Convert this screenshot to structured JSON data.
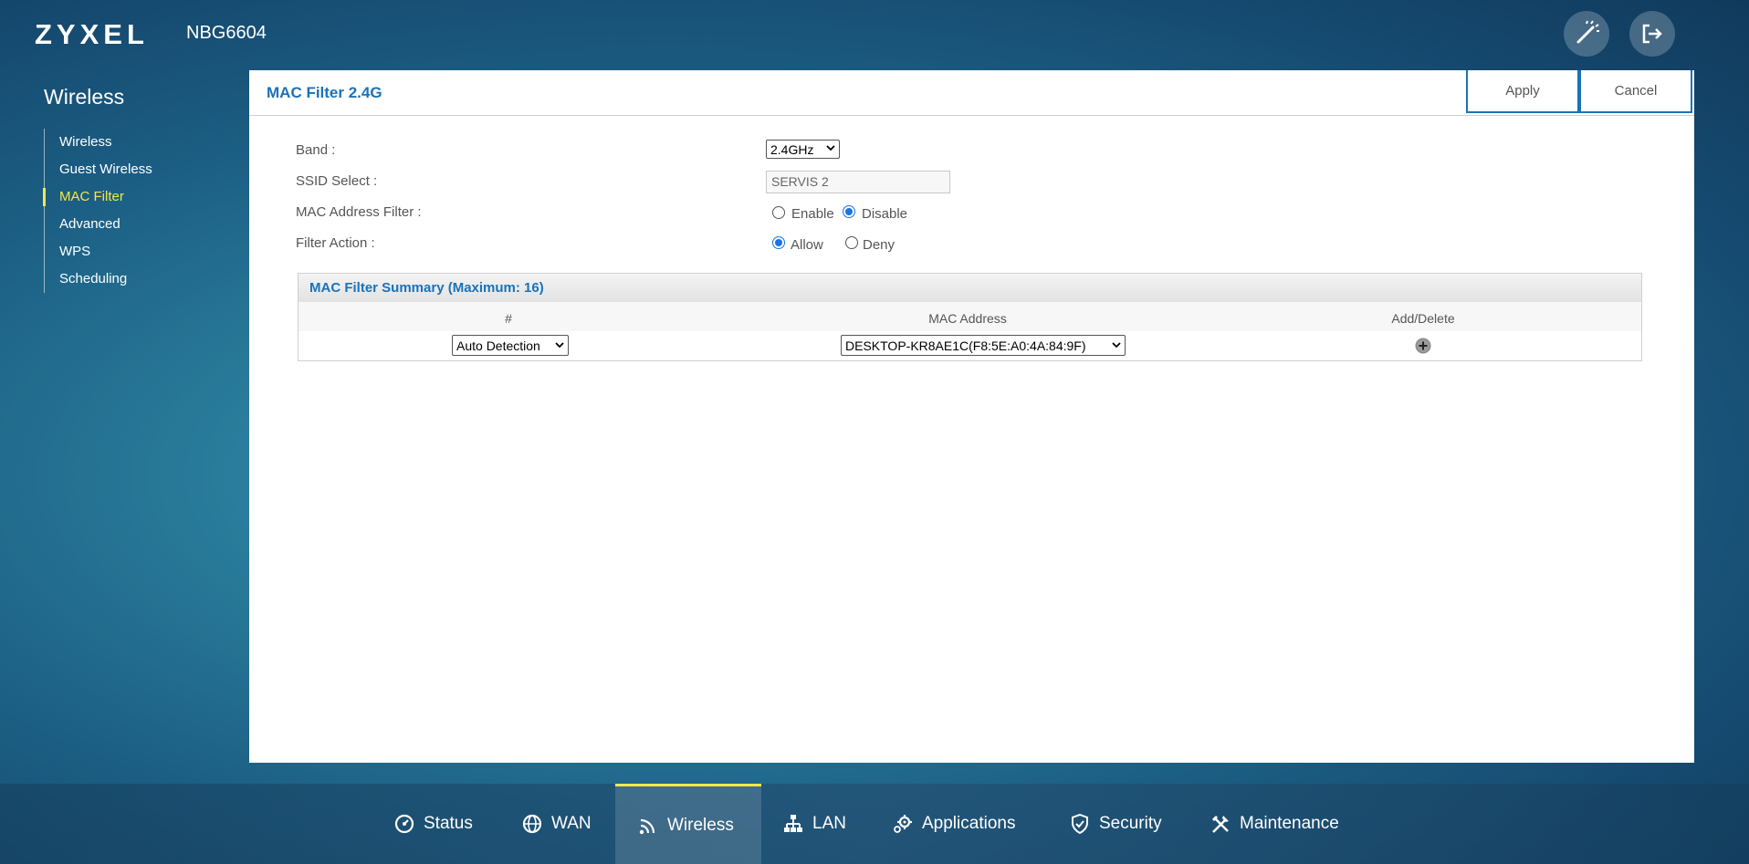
{
  "header": {
    "brand": "ZYXEL",
    "model": "NBG6604"
  },
  "sidebar": {
    "title": "Wireless",
    "items": [
      {
        "label": "Wireless"
      },
      {
        "label": "Guest Wireless"
      },
      {
        "label": "MAC Filter"
      },
      {
        "label": "Advanced"
      },
      {
        "label": "WPS"
      },
      {
        "label": "Scheduling"
      }
    ]
  },
  "panel": {
    "title": "MAC Filter 2.4G",
    "apply_label": "Apply",
    "cancel_label": "Cancel"
  },
  "form": {
    "band_label": "Band :",
    "band_value": "2.4GHz",
    "ssid_label": "SSID Select :",
    "ssid_value": "SERVIS 2",
    "mac_filter_label": "MAC Address Filter :",
    "mac_filter_enable": "Enable",
    "mac_filter_disable": "Disable",
    "mac_filter_selected": "Disable",
    "filter_action_label": "Filter Action :",
    "filter_action_allow": "Allow",
    "filter_action_deny": "Deny",
    "filter_action_selected": "Allow"
  },
  "summary": {
    "title": "MAC Filter Summary (Maximum: 16)",
    "columns": [
      "#",
      "MAC Address",
      "Add/Delete"
    ],
    "row": {
      "number_select": "Auto Detection",
      "mac_select": "DESKTOP-KR8AE1C(F8:5E:A0:4A:84:9F)"
    }
  },
  "bottom_nav": [
    {
      "label": "Status",
      "icon": "status-icon"
    },
    {
      "label": "WAN",
      "icon": "globe-icon"
    },
    {
      "label": "Wireless",
      "icon": "wifi-icon"
    },
    {
      "label": "LAN",
      "icon": "network-icon"
    },
    {
      "label": "Applications",
      "icon": "gear-icon"
    },
    {
      "label": "Security",
      "icon": "shield-icon"
    },
    {
      "label": "Maintenance",
      "icon": "tools-icon"
    }
  ],
  "colors": {
    "accent": "#1b72b8",
    "active": "#f3e74a"
  }
}
